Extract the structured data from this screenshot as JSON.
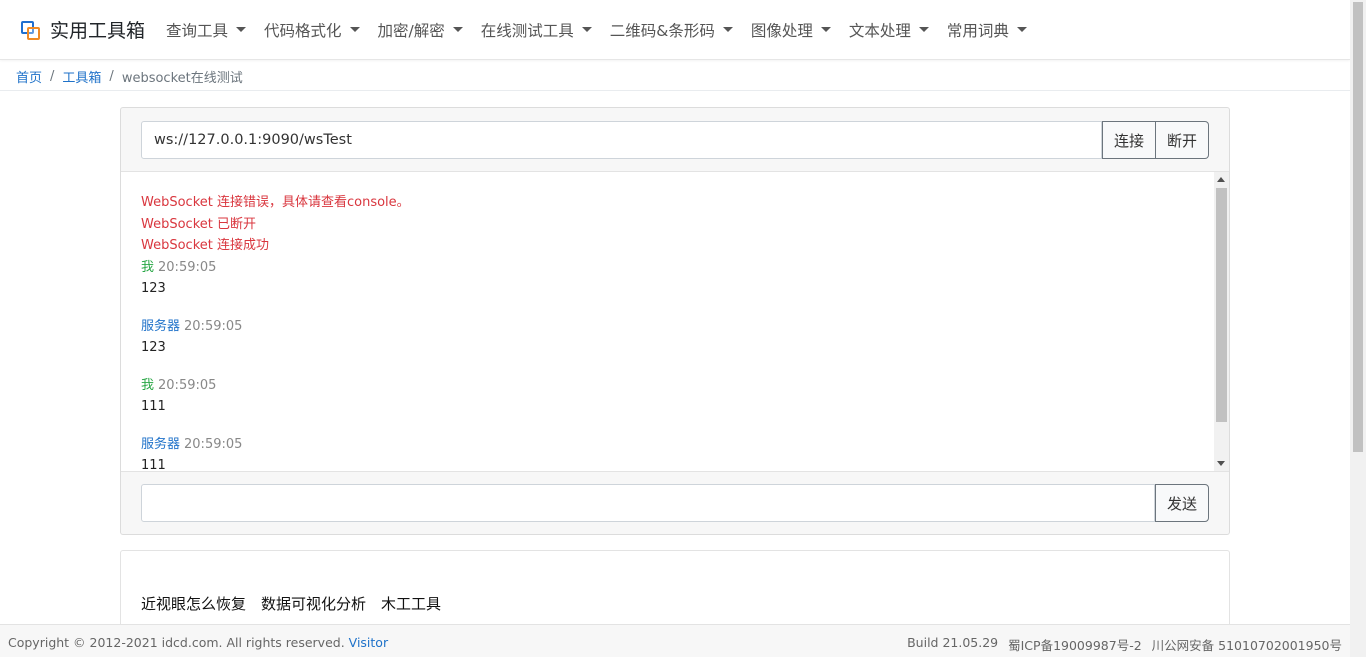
{
  "brand": {
    "title": "实用工具箱"
  },
  "nav": {
    "items": [
      {
        "label": "查询工具"
      },
      {
        "label": "代码格式化"
      },
      {
        "label": "加密/解密"
      },
      {
        "label": "在线测试工具"
      },
      {
        "label": "二维码&条形码"
      },
      {
        "label": "图像处理"
      },
      {
        "label": "文本处理"
      },
      {
        "label": "常用词典"
      }
    ]
  },
  "breadcrumb": {
    "home": "首页",
    "toolbox": "工具箱",
    "current": "websocket在线测试"
  },
  "ws": {
    "url": "ws://127.0.0.1:9090/wsTest",
    "connect_label": "连接",
    "disconnect_label": "断开",
    "send_label": "发送",
    "send_value": ""
  },
  "messages": {
    "status": [
      "WebSocket 连接错误，具体请查看console。",
      "WebSocket 已断开",
      "WebSocket 连接成功"
    ],
    "entries": [
      {
        "sender": "我",
        "time": "20:59:05",
        "content": "123"
      },
      {
        "sender": "服务器",
        "time": "20:59:05",
        "content": "123"
      },
      {
        "sender": "我",
        "time": "20:59:05",
        "content": "111"
      },
      {
        "sender": "服务器",
        "time": "20:59:05",
        "content": "111"
      }
    ]
  },
  "links": [
    "近视眼怎么恢复",
    "数据可视化分析",
    "木工工具"
  ],
  "footer": {
    "copyright": "Copyright © 2012-2021 idcd.com. All rights reserved.",
    "visitor": "Visitor",
    "build": "Build 21.05.29",
    "icp": "蜀ICP备19009987号-2",
    "police": "川公网安备 51010702001950号"
  },
  "colors": {
    "link_blue": "#1f72c9",
    "error_red": "#d9363e",
    "me_green": "#28a745",
    "logo_blue": "#1f6fd0",
    "logo_orange": "#f08a24"
  }
}
